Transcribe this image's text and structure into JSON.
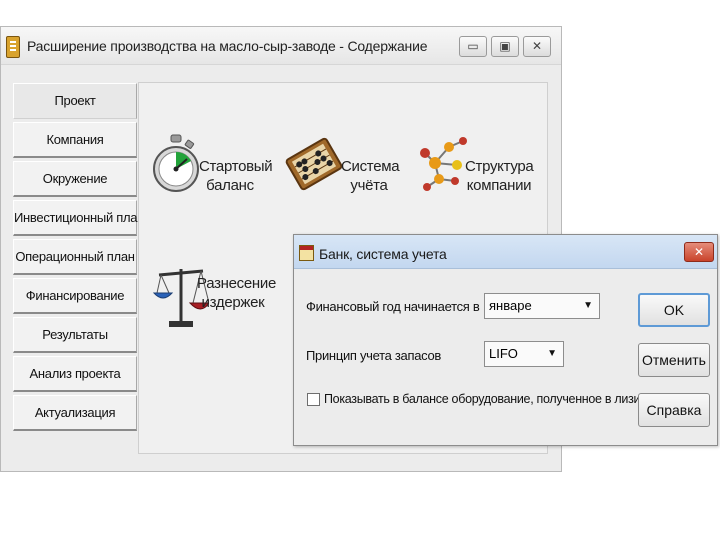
{
  "main_window": {
    "title": "Расширение производства на масло-сыр-заводе - Содержание",
    "controls": {
      "minimize": "▭",
      "maximize": "▣",
      "close": "✕"
    },
    "nav_tabs": [
      "Проект",
      "Компания",
      "Окружение",
      "Инвестиционный план",
      "Операционный план",
      "Финансирование",
      "Результаты",
      "Анализ проекта",
      "Актуализация"
    ],
    "tools": {
      "start_balance": {
        "line1": "Стартовый",
        "line2": "баланс"
      },
      "accounting_system": {
        "line1": "Система",
        "line2": "учёта"
      },
      "company_structure": {
        "line1": "Структура",
        "line2": "компании"
      },
      "cost_allocation": {
        "line1": "Разнесение",
        "line2": "издержек"
      }
    }
  },
  "dialog": {
    "title": "Банк, система учета",
    "close": "✕",
    "fiscal_year_label": "Финансовый год начинается в",
    "fiscal_year_value": "январе",
    "inventory_label": "Принцип учета запасов",
    "inventory_value": "LIFO",
    "lease_checkbox_label": "Показывать в балансе оборудование, полученное в лизинг",
    "lease_checked": false,
    "buttons": {
      "ok": "OK",
      "cancel": "Отменить",
      "help": "Справка"
    }
  },
  "colors": {
    "dialog_titlebar": "#c3d7ef",
    "close_button": "#c9432b",
    "ok_focus_border": "#5e9ad6"
  }
}
